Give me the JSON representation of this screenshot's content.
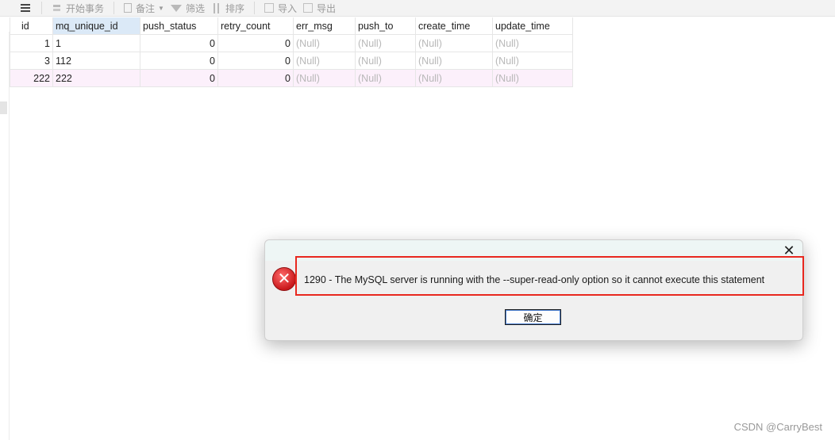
{
  "toolbar": {
    "begin_transaction": "开始事务",
    "memo": "备注",
    "filter": "筛选",
    "sort": "排序",
    "import": "导入",
    "export": "导出"
  },
  "grid": {
    "columns": [
      "id",
      "mq_unique_id",
      "push_status",
      "retry_count",
      "err_msg",
      "push_to",
      "create_time",
      "update_time"
    ],
    "rows": [
      [
        "1",
        "1",
        "0",
        "0",
        "(Null)",
        "(Null)",
        "(Null)",
        "(Null)"
      ],
      [
        "3",
        "112",
        "0",
        "0",
        "(Null)",
        "(Null)",
        "(Null)",
        "(Null)"
      ],
      [
        "222",
        "222",
        "0",
        "0",
        "(Null)",
        "(Null)",
        "(Null)",
        "(Null)"
      ]
    ]
  },
  "dialog": {
    "message": "1290 - The MySQL server is running with the --super-read-only option so it cannot execute this statement",
    "ok_label": "确定",
    "close_glyph": "✕",
    "error_glyph": "✕"
  },
  "watermark": "CSDN @CarryBest"
}
